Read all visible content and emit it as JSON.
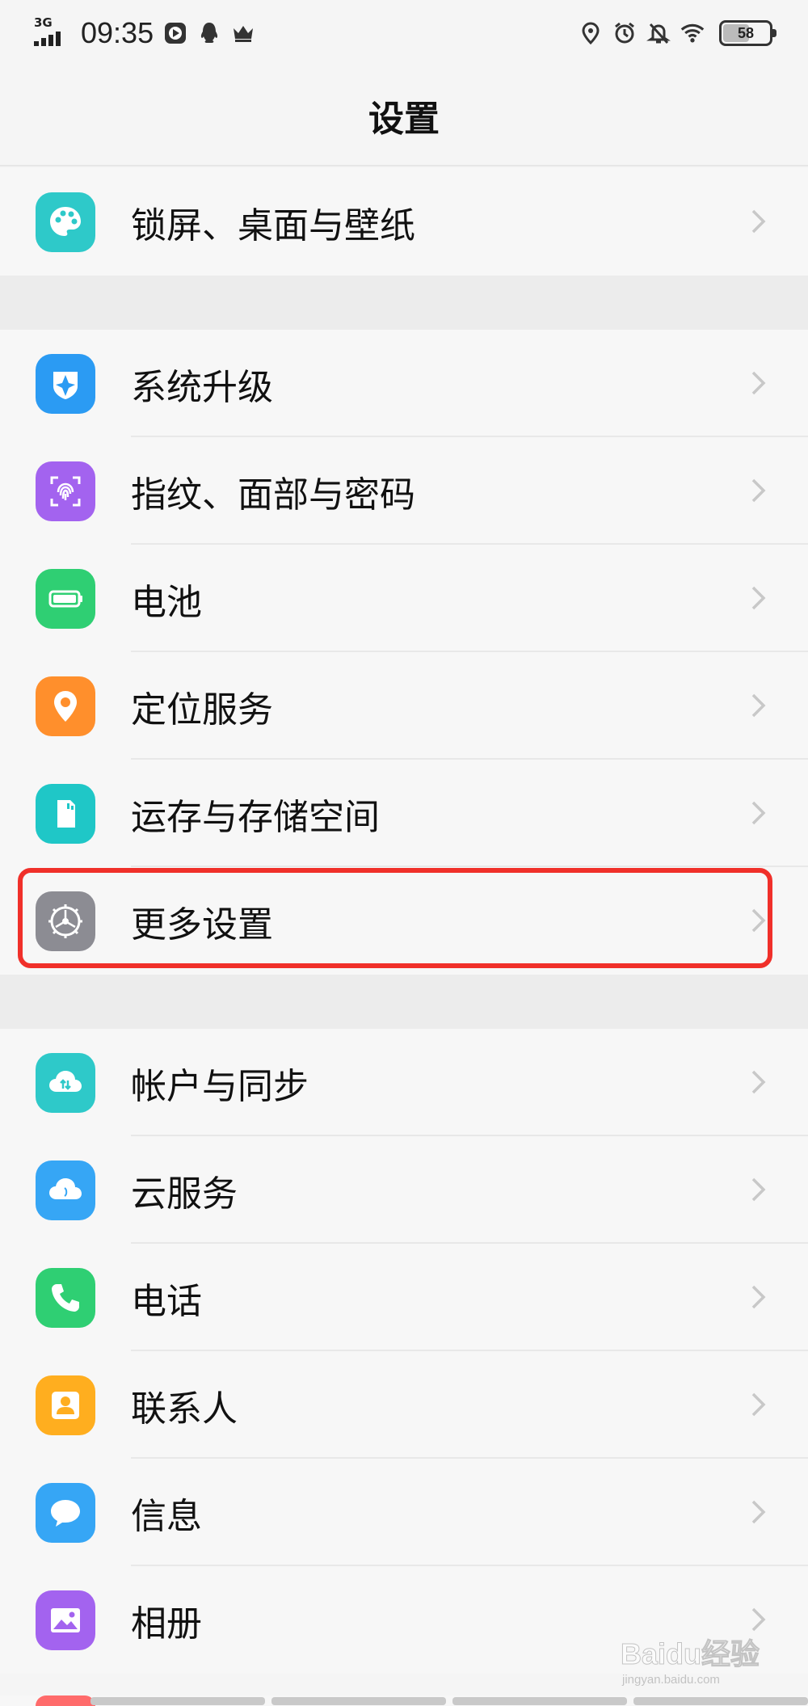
{
  "status_bar": {
    "network": "3G",
    "time": "09:35",
    "battery": "58",
    "battery_level": 0.58
  },
  "header": {
    "title": "设置"
  },
  "groups": [
    {
      "items": [
        {
          "label": "锁屏、桌面与壁纸",
          "icon": "palette-icon",
          "color": "#2ec9c9"
        }
      ]
    },
    {
      "items": [
        {
          "label": "系统升级",
          "icon": "upgrade-icon",
          "color": "#2b9bf3"
        },
        {
          "label": "指纹、面部与密码",
          "icon": "fingerprint-icon",
          "color": "#a363ef"
        },
        {
          "label": "电池",
          "icon": "battery-icon",
          "color": "#2fcf73"
        },
        {
          "label": "定位服务",
          "icon": "location-icon",
          "color": "#ff8f2c"
        },
        {
          "label": "运存与存储空间",
          "icon": "sd-card-icon",
          "color": "#1fc7c7"
        },
        {
          "label": "更多设置",
          "icon": "gear-icon",
          "color": "#8c8c93"
        }
      ]
    },
    {
      "items": [
        {
          "label": "帐户与同步",
          "icon": "account-sync-icon",
          "color": "#2ec9c9"
        },
        {
          "label": "云服务",
          "icon": "cloud-icon",
          "color": "#36a6f5"
        },
        {
          "label": "电话",
          "icon": "phone-icon",
          "color": "#2fcf73"
        },
        {
          "label": "联系人",
          "icon": "contact-icon",
          "color": "#ffae1f"
        },
        {
          "label": "信息",
          "icon": "message-icon",
          "color": "#36a6f5"
        },
        {
          "label": "相册",
          "icon": "album-icon",
          "color": "#a363ef"
        }
      ]
    }
  ],
  "highlighted_item": "更多设置",
  "watermark": {
    "text": "Baidu经验",
    "sub": "jingyan.baidu.com"
  }
}
